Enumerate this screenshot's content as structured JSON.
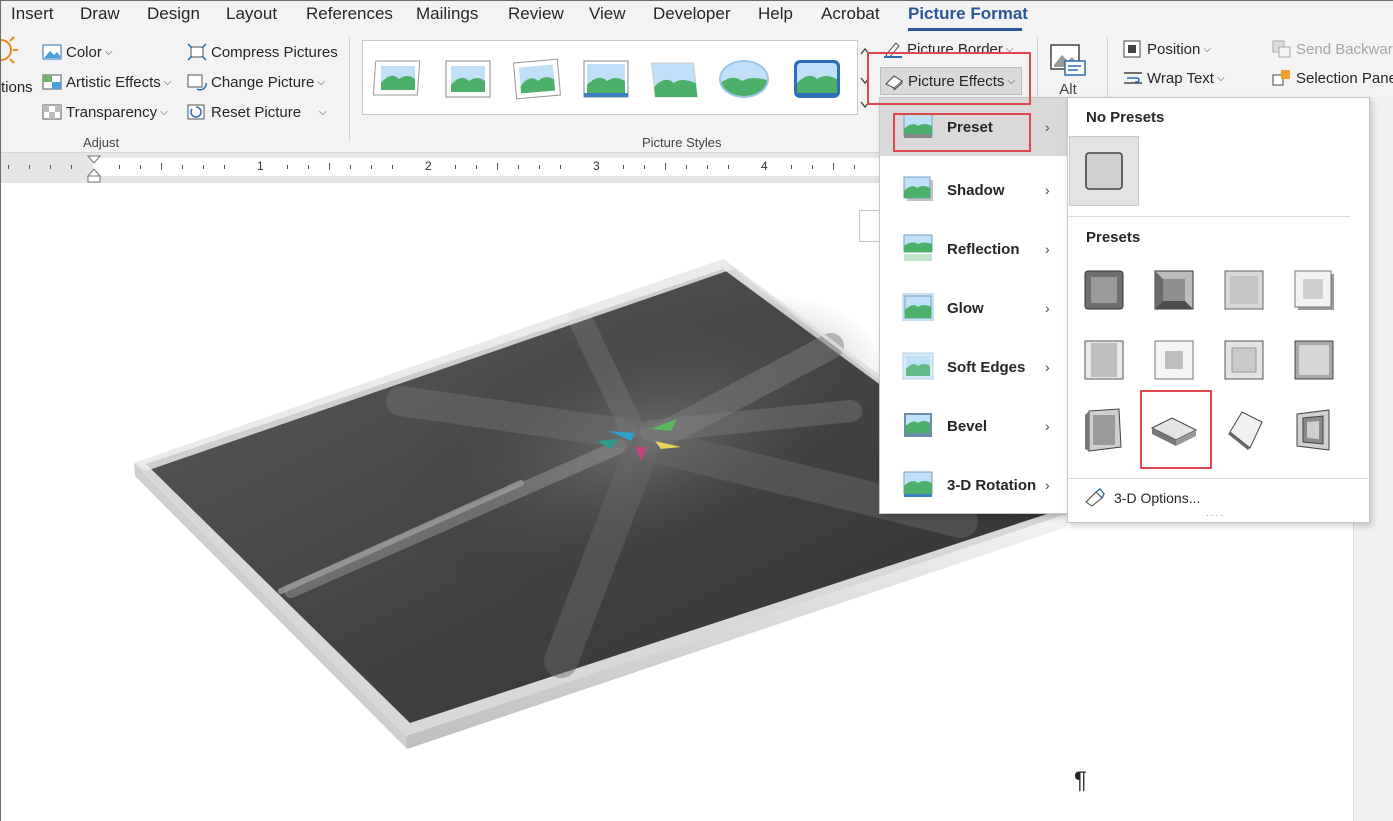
{
  "tabs": [
    "Insert",
    "Draw",
    "Design",
    "Layout",
    "References",
    "Mailings",
    "Review",
    "View",
    "Developer",
    "Help",
    "Acrobat",
    "Picture Format"
  ],
  "active_tab": "Picture Format",
  "adjust": {
    "corrections_label": "tions",
    "color": "Color",
    "artistic_effects": "Artistic Effects",
    "transparency": "Transparency",
    "compress": "Compress Pictures",
    "change_picture": "Change Picture",
    "reset_picture": "Reset Picture",
    "group_label": "Adjust"
  },
  "picture_styles": {
    "group_label": "Picture Styles",
    "count": 7
  },
  "picture_tools": {
    "border": "Picture Border",
    "effects": "Picture Effects",
    "alt": "Alt"
  },
  "arrange": {
    "position": "Position",
    "wrap_text": "Wrap Text",
    "send_backward": "Send Backward",
    "selection_pane": "Selection Pane"
  },
  "ruler": [
    "1",
    "2",
    "3",
    "4"
  ],
  "effects_menu": [
    {
      "label": "Preset",
      "icon": "preset-icon",
      "hover": true
    },
    {
      "label": "Shadow",
      "icon": "shadow-icon"
    },
    {
      "label": "Reflection",
      "icon": "reflection-icon"
    },
    {
      "label": "Glow",
      "icon": "glow-icon"
    },
    {
      "label": "Soft Edges",
      "icon": "soft-edges-icon"
    },
    {
      "label": "Bevel",
      "icon": "bevel-icon"
    },
    {
      "label": "3-D Rotation",
      "icon": "3d-rotation-icon"
    }
  ],
  "preset_submenu": {
    "no_presets": "No Presets",
    "presets": "Presets",
    "options": "3-D Options...",
    "selected_index": 9
  },
  "doc": {
    "pilcrow": "¶"
  },
  "colors": {
    "accent": "#2b579a",
    "highlight": "#e0474c",
    "hover": "#d9d9d9"
  }
}
